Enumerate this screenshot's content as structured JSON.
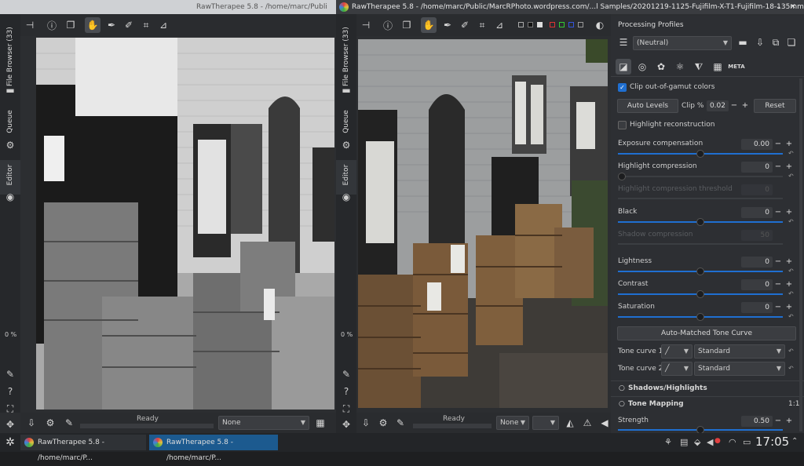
{
  "left_window": {
    "title": "RawTherapee 5.8 - /home/marc/Publi",
    "side_tabs": [
      "File Browser (33)",
      "Queue",
      "Editor"
    ],
    "zoom_percent": "0 %",
    "status": "Ready",
    "combo_value": "None"
  },
  "right_window": {
    "title": "RawTherapee 5.8 - /home/marc/Public/MarcRPhoto.wordpress.com/...l Samples/20201219-1125-Fujifilm-X-T1-Fujifilm-18-135mm-1.raf",
    "side_tabs": [
      "File Browser (33)",
      "Queue",
      "Editor"
    ],
    "zoom_percent": "0 %",
    "status": "Ready",
    "combo_value": "None"
  },
  "panel": {
    "profiles_label": "Processing Profiles",
    "profile_value": "(Neutral)",
    "clip_gamut_label": "Clip out-of-gamut colors",
    "auto_levels_label": "Auto Levels",
    "clip_label": "Clip %",
    "clip_value": "0.02",
    "reset_label": "Reset",
    "highlight_reconstruction_label": "Highlight reconstruction",
    "exposure_label": "Exposure compensation",
    "exposure_value": "0.00",
    "highlight_compression_label": "Highlight compression",
    "highlight_compression_value": "0",
    "hc_threshold_label": "Highlight compression threshold",
    "hc_threshold_value": "0",
    "black_label": "Black",
    "black_value": "0",
    "shadow_compression_label": "Shadow compression",
    "shadow_compression_value": "50",
    "lightness_label": "Lightness",
    "lightness_value": "0",
    "contrast_label": "Contrast",
    "contrast_value": "0",
    "saturation_label": "Saturation",
    "saturation_value": "0",
    "auto_matched_label": "Auto-Matched Tone Curve",
    "tone_curve1_label": "Tone curve 1:",
    "tone_curve1_value": "Standard",
    "tone_curve2_label": "Tone curve 2:",
    "tone_curve2_value": "Standard",
    "shadows_highlights_label": "Shadows/Highlights",
    "tone_mapping_label": "Tone Mapping",
    "tone_mapping_ratio": "1:1",
    "strength_label": "Strength",
    "strength_value": "0.50",
    "tool_tab_meta": "META"
  },
  "taskbar": {
    "task1": "RawTherapee 5.8 - /home/marc/P...",
    "task2": "RawTherapee 5.8 - /home/marc/P...",
    "clock": "17:05"
  },
  "colors": {
    "accent": "#1f6fd1",
    "window_bg": "#2c2e31",
    "taskbar_active": "#1c5a8f"
  }
}
